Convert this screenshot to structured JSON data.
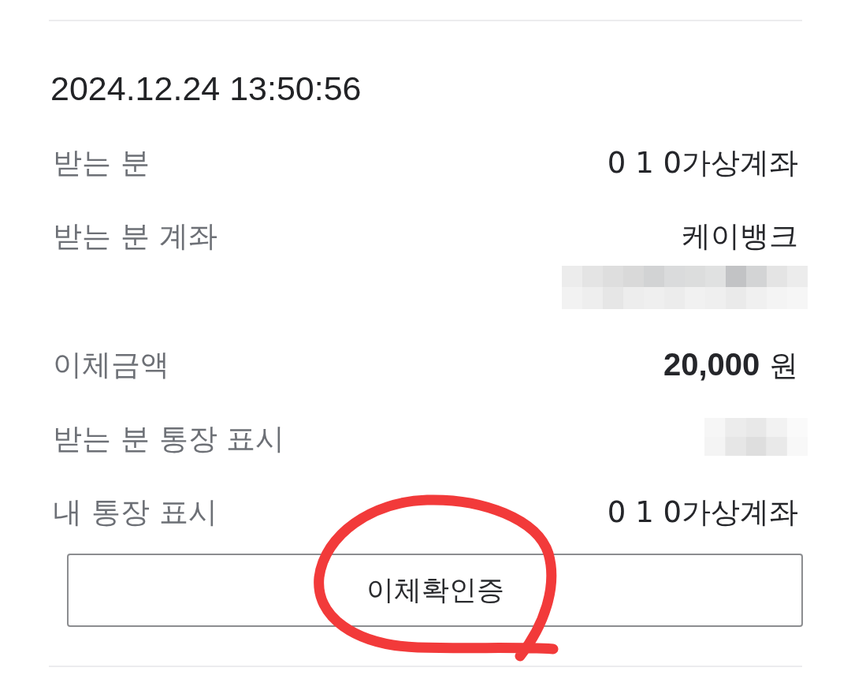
{
  "datetime": "2024.12.24 13:50:56",
  "rows": [
    {
      "label": "받는 분",
      "value": "0 1 0가상계좌",
      "blurred": false
    },
    {
      "label": "받는 분 계좌",
      "value": "케이뱅크",
      "blurred": true
    },
    {
      "label": "이체금액",
      "value": "**20,000** 원",
      "blurred": false
    },
    {
      "label": "받는 분 통장 표시",
      "blurred": true
    },
    {
      "label": "내 통장 표시",
      "value": "0 1 0가상계좌",
      "blurred": false
    }
  ],
  "button": {
    "label": "이체확인증"
  },
  "annotation": {
    "kind": "circle",
    "color": "#f23a3a"
  }
}
